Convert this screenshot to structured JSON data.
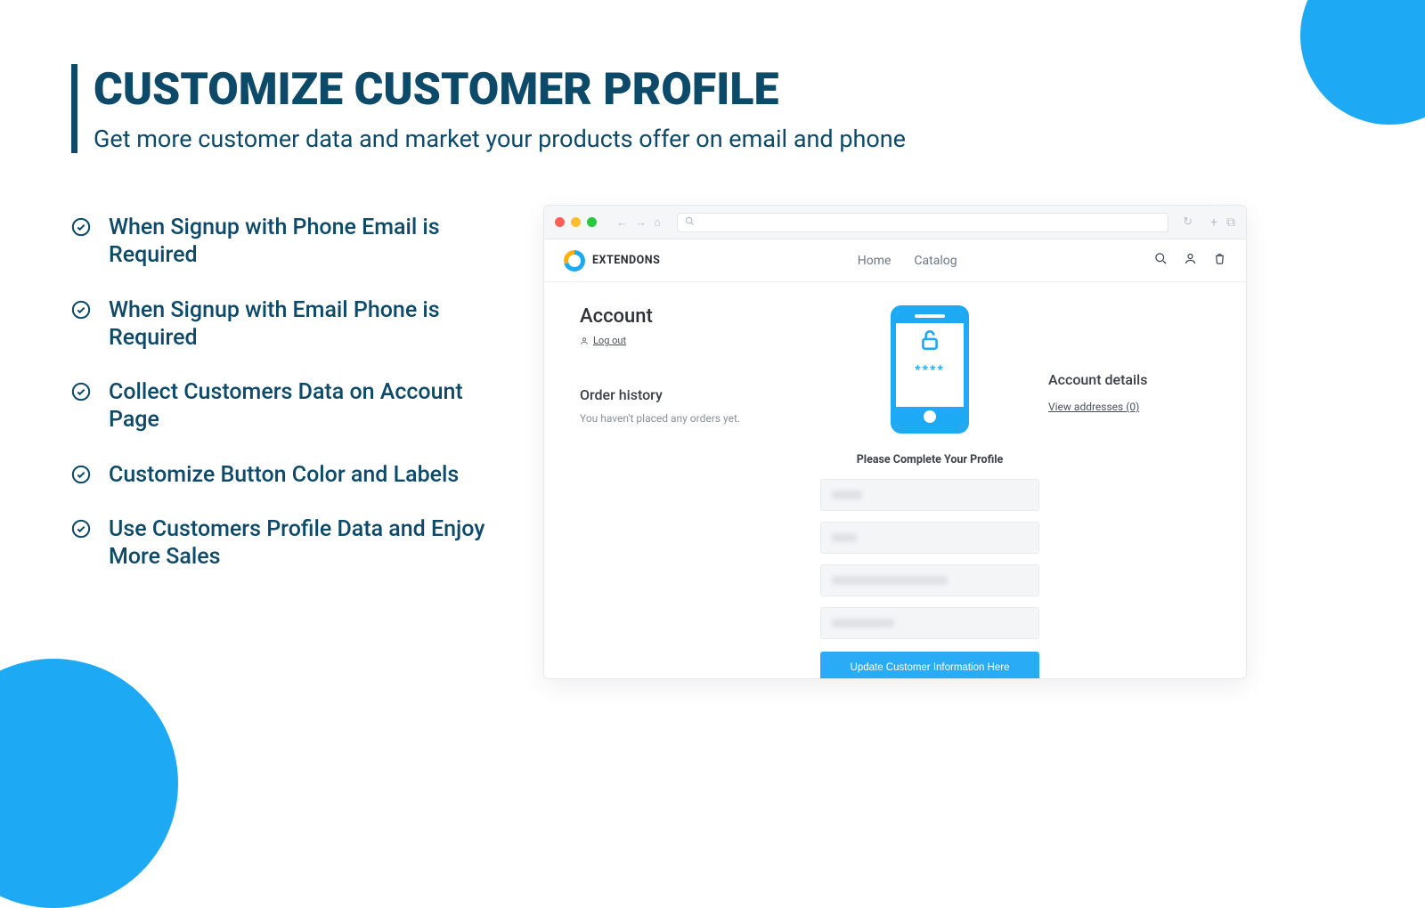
{
  "hero": {
    "title": "CUSTOMIZE CUSTOMER PROFILE",
    "subtitle": "Get more customer data and market your products offer on email and phone"
  },
  "features": [
    "When Signup with Phone Email is Required",
    "When Signup with Email Phone is Required",
    "Collect Customers Data on Account Page",
    "Customize Button Color and Labels",
    "Use Customers Profile Data and Enjoy More Sales"
  ],
  "browser": {
    "brand_name": "EXTENDONS",
    "nav": {
      "home": "Home",
      "catalog": "Catalog"
    }
  },
  "account": {
    "title": "Account",
    "logout": "Log out",
    "order_history_title": "Order history",
    "order_history_empty": "You haven't placed any orders yet.",
    "details_title": "Account details",
    "view_addresses": "View addresses (0)",
    "complete_prompt": "Please Complete Your Profile",
    "update_button": "Update Customer Information Here",
    "phone_stars": "****"
  }
}
